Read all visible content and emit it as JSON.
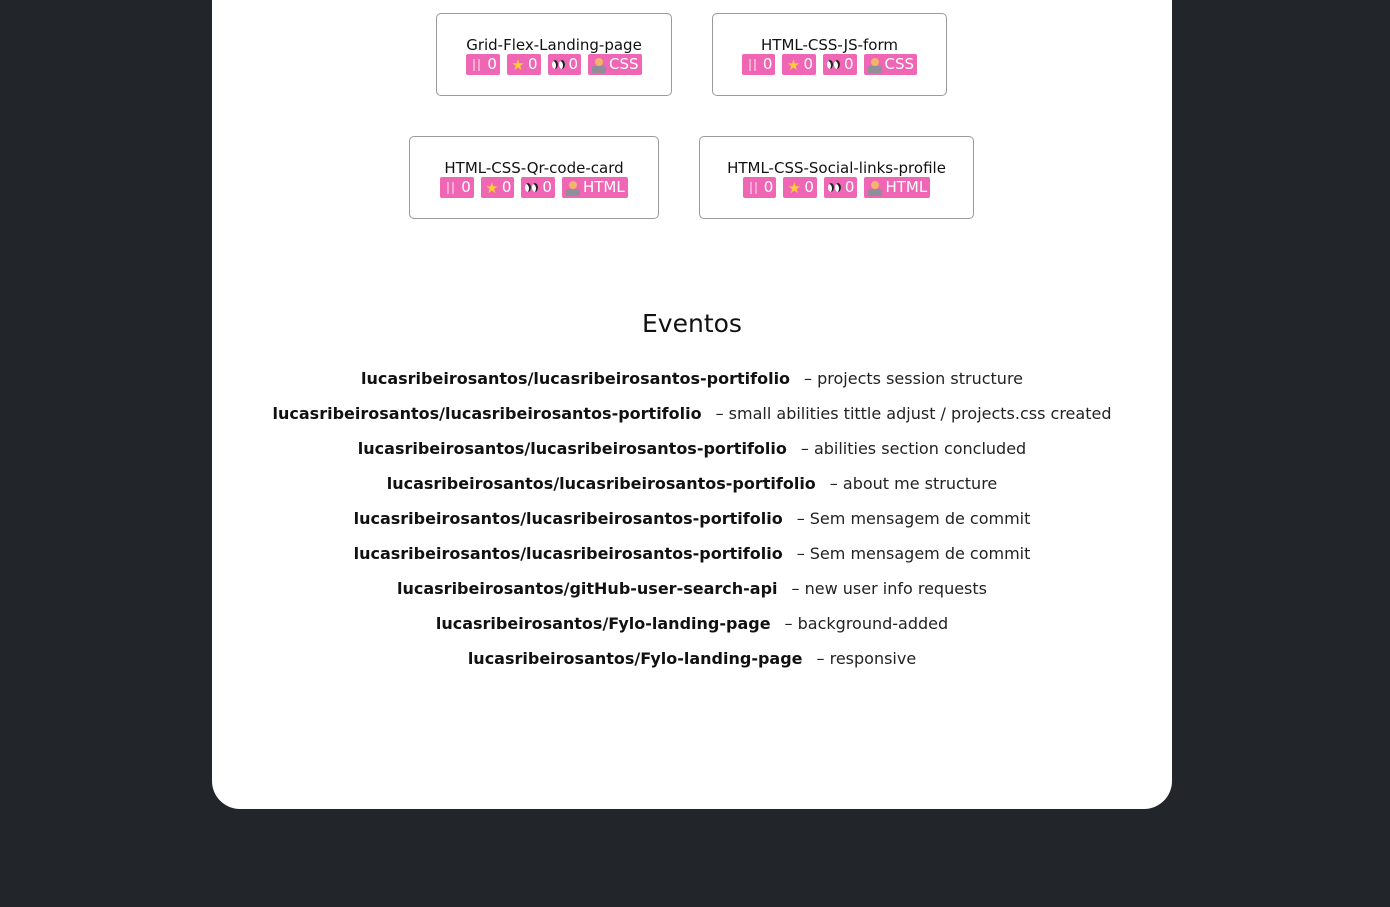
{
  "projects": [
    {
      "name": "Grid-Flex-Landing-page",
      "forks": "0",
      "stars": "0",
      "watchers": "0",
      "language": "CSS"
    },
    {
      "name": "HTML-CSS-JS-form",
      "forks": "0",
      "stars": "0",
      "watchers": "0",
      "language": "CSS"
    },
    {
      "name": "HTML-CSS-Qr-code-card",
      "forks": "0",
      "stars": "0",
      "watchers": "0",
      "language": "HTML"
    },
    {
      "name": "HTML-CSS-Social-links-profile",
      "forks": "0",
      "stars": "0",
      "watchers": "0",
      "language": "HTML"
    }
  ],
  "events": {
    "title": "Eventos",
    "items": [
      {
        "repo": "lucasribeirosantos/lucasribeirosantos-portifolio",
        "message": "– projects session structure"
      },
      {
        "repo": "lucasribeirosantos/lucasribeirosantos-portifolio",
        "message": "– small abilities tittle adjust / projects.css created"
      },
      {
        "repo": "lucasribeirosantos/lucasribeirosantos-portifolio",
        "message": "– abilities section concluded"
      },
      {
        "repo": "lucasribeirosantos/lucasribeirosantos-portifolio",
        "message": "– about me structure"
      },
      {
        "repo": "lucasribeirosantos/lucasribeirosantos-portifolio",
        "message": "– Sem mensagem de commit"
      },
      {
        "repo": "lucasribeirosantos/lucasribeirosantos-portifolio",
        "message": "– Sem mensagem de commit"
      },
      {
        "repo": "lucasribeirosantos/gitHub-user-search-api",
        "message": "– new user info requests"
      },
      {
        "repo": "lucasribeirosantos/Fylo-landing-page",
        "message": "– background-added"
      },
      {
        "repo": "lucasribeirosantos/Fylo-landing-page",
        "message": "– responsive"
      }
    ]
  },
  "icons": {
    "forks": "fork-icon",
    "stars": "star-icon",
    "watchers": "eyes-icon",
    "language": "coder-icon"
  },
  "colors": {
    "background": "#22262a",
    "panel": "#ffffff",
    "badge": "#ef66b4",
    "star": "#ffcc33"
  }
}
